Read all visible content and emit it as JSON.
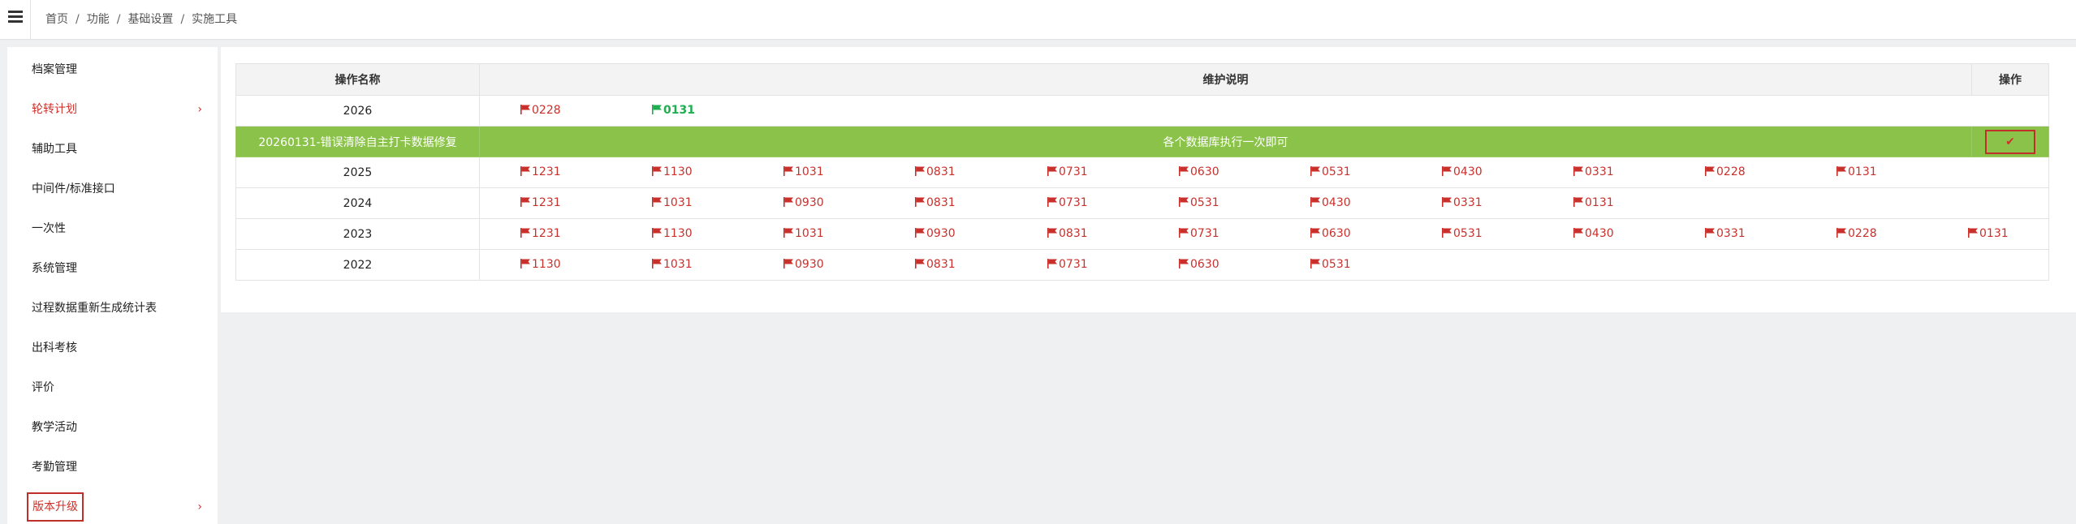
{
  "breadcrumb": [
    "首页",
    "功能",
    "基础设置",
    "实施工具"
  ],
  "sidebar": {
    "items": [
      {
        "label": "档案管理",
        "active": false,
        "has_arrow": false
      },
      {
        "label": "轮转计划",
        "active": true,
        "has_arrow": true
      },
      {
        "label": "辅助工具",
        "active": false,
        "has_arrow": false
      },
      {
        "label": "中间件/标准接口",
        "active": false,
        "has_arrow": false
      },
      {
        "label": "一次性",
        "active": false,
        "has_arrow": false
      },
      {
        "label": "系统管理",
        "active": false,
        "has_arrow": false
      },
      {
        "label": "过程数据重新生成统计表",
        "active": false,
        "has_arrow": false
      },
      {
        "label": "出科考核",
        "active": false,
        "has_arrow": false
      },
      {
        "label": "评价",
        "active": false,
        "has_arrow": false
      },
      {
        "label": "教学活动",
        "active": false,
        "has_arrow": false
      },
      {
        "label": "考勤管理",
        "active": false,
        "has_arrow": false
      },
      {
        "label": "版本升级",
        "active": true,
        "has_arrow": true,
        "boxed": true
      }
    ],
    "arrow_glyph": "›"
  },
  "table": {
    "headers": {
      "name": "操作名称",
      "desc": "维护说明",
      "op": "操作"
    },
    "rows": [
      {
        "type": "flags",
        "name": "2026",
        "flags": [
          {
            "label": "0228",
            "color": "red"
          },
          {
            "label": "0131",
            "color": "green"
          }
        ]
      },
      {
        "type": "highlight",
        "name": "20260131-错误清除自主打卡数据修复",
        "desc": "各个数据库执行一次即可",
        "op": "✔"
      },
      {
        "type": "flags",
        "name": "2025",
        "flags": [
          {
            "label": "1231"
          },
          {
            "label": "1130"
          },
          {
            "label": "1031"
          },
          {
            "label": "0831"
          },
          {
            "label": "0731"
          },
          {
            "label": "0630"
          },
          {
            "label": "0531"
          },
          {
            "label": "0430"
          },
          {
            "label": "0331"
          },
          {
            "label": "0228"
          },
          {
            "label": "0131"
          }
        ]
      },
      {
        "type": "flags",
        "name": "2024",
        "flags": [
          {
            "label": "1231"
          },
          {
            "label": "1031"
          },
          {
            "label": "0930"
          },
          {
            "label": "0831"
          },
          {
            "label": "0731"
          },
          {
            "label": "0531"
          },
          {
            "label": "0430"
          },
          {
            "label": "0331"
          },
          {
            "label": "0131"
          }
        ]
      },
      {
        "type": "flags",
        "name": "2023",
        "flags": [
          {
            "label": "1231"
          },
          {
            "label": "1130"
          },
          {
            "label": "1031"
          },
          {
            "label": "0930"
          },
          {
            "label": "0831"
          },
          {
            "label": "0731"
          },
          {
            "label": "0630"
          },
          {
            "label": "0531"
          },
          {
            "label": "0430"
          },
          {
            "label": "0331"
          },
          {
            "label": "0228"
          },
          {
            "label": "0131"
          }
        ]
      },
      {
        "type": "flags",
        "name": "2022",
        "flags": [
          {
            "label": "1130"
          },
          {
            "label": "1031"
          },
          {
            "label": "0930"
          },
          {
            "label": "0831"
          },
          {
            "label": "0731"
          },
          {
            "label": "0630"
          },
          {
            "label": "0531"
          }
        ]
      }
    ]
  },
  "colors": {
    "red": "#c9302c",
    "green": "#1fae4f",
    "highlight_row": "#8bc34a",
    "sidebar_active": "#d0302a"
  },
  "icons": {
    "flag": "flag-icon",
    "menu": "hamburger-menu-icon",
    "check": "check-icon"
  }
}
